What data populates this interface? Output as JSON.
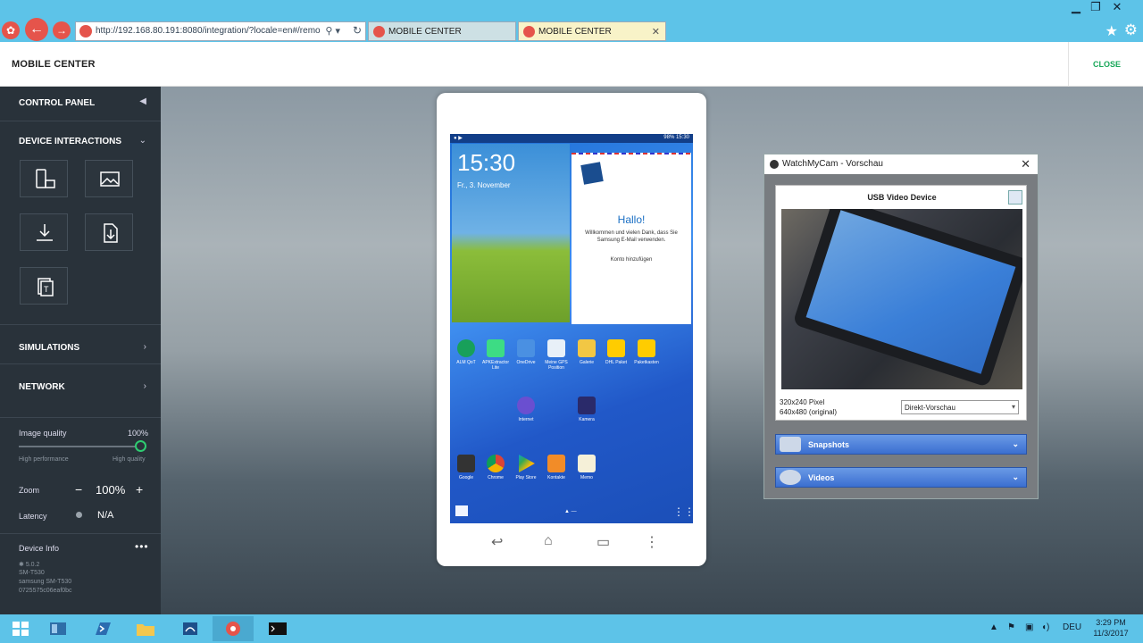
{
  "browser": {
    "url": "http://192.168.80.191:8080/integration/?locale=en#/remo",
    "tabs": [
      {
        "label": "MOBILE CENTER"
      },
      {
        "label": "MOBILE CENTER"
      }
    ]
  },
  "header": {
    "title": "MOBILE CENTER",
    "close_label": "CLOSE"
  },
  "sidebar": {
    "control_panel": "CONTROL PANEL",
    "device_interactions": "DEVICE INTERACTIONS",
    "simulations": "SIMULATIONS",
    "network": "NETWORK",
    "image_quality_label": "Image quality",
    "image_quality_value": "100%",
    "image_quality_fraction": 1.0,
    "high_performance": "High performance",
    "high_quality": "High quality",
    "zoom_label": "Zoom",
    "zoom_minus": "−",
    "zoom_value": "100%",
    "zoom_plus": "+",
    "latency_label": "Latency",
    "latency_value": "N/A",
    "device_info_label": "Device Info",
    "device_os": "5.0.2",
    "device_model": "SM-T530",
    "device_name": "samsung SM-T530",
    "device_id": "0725575c06eaf0bc"
  },
  "phone": {
    "status_right": "98% 15:30",
    "clock_time": "15:30",
    "clock_date": "Fr., 3. November",
    "email_greeting": "Hallo!",
    "email_text": "Willkommen und vielen Dank, dass Sie Samsung E-Mail verwenden.",
    "email_link": "Konto hinzufügen",
    "apps_row1": [
      {
        "label": "ALM QoT",
        "color": "#18a05a"
      },
      {
        "label": "APKExtractor Lite",
        "color": "#3ddc84"
      },
      {
        "label": "OneDrive",
        "color": "#4a90e2"
      },
      {
        "label": "Meine GPS Position",
        "color": "#e8f0f8"
      },
      {
        "label": "Galerie",
        "color": "#f2c744"
      },
      {
        "label": "DHL Paket",
        "color": "#ffcc00"
      },
      {
        "label": "Paketkasten",
        "color": "#ffcc00"
      }
    ],
    "apps_row2": [
      {
        "label": "Internet",
        "color": "#6a4fd0"
      },
      {
        "label": "Kamera",
        "color": "#2a2a6a"
      }
    ],
    "apps_row3": [
      {
        "label": "Google",
        "color": "#333"
      },
      {
        "label": "Chrome",
        "color": "#db4437"
      },
      {
        "label": "Play Store",
        "color": "#00a0e0"
      },
      {
        "label": "Kontakte",
        "color": "#f28c28"
      },
      {
        "label": "Memo",
        "color": "#f5f0d8"
      }
    ]
  },
  "webcam": {
    "title": "WatchMyCam - Vorschau",
    "device": "USB Video Device",
    "res1": "320x240 Pixel",
    "res2": "640x480 (original)",
    "preview_mode": "Direkt-Vorschau",
    "snapshots": "Snapshots",
    "videos": "Videos"
  },
  "taskbar": {
    "lang": "DEU",
    "time": "3:29 PM",
    "date": "11/3/2017"
  },
  "colors": {
    "accent": "#1aa85a",
    "chrome": "#5dc3e8",
    "sidebar": "#29323a",
    "brand": "#e5544b"
  }
}
